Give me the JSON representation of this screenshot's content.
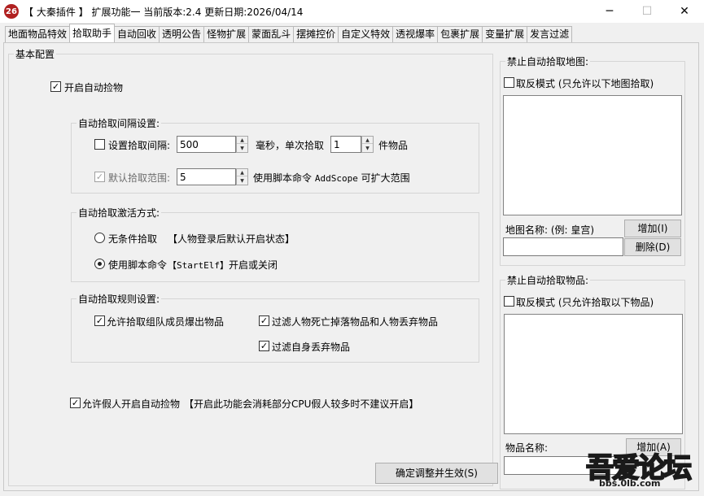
{
  "window": {
    "icon_text": "26",
    "title": "【 大秦插件 】 扩展功能一 当前版本:2.4 更新日期:2026/04/14",
    "minimize": "─",
    "maximize": "☐",
    "close": "✕"
  },
  "tabs": [
    "地面物品特效",
    "拾取助手",
    "自动回收",
    "透明公告",
    "怪物扩展",
    "蒙面乱斗",
    "摆摊控价",
    "自定义特效",
    "透视爆率",
    "包裹扩展",
    "变量扩展",
    "发言过滤"
  ],
  "active_tab": "拾取助手",
  "basic": {
    "legend": "基本配置",
    "auto_pickup": {
      "label": "开启自动捡物",
      "checked": true
    },
    "interval": {
      "legend": "自动拾取间隔设置:",
      "checkbox_label": "设置拾取间隔:",
      "checked": false,
      "interval_value": "500",
      "ms_label": "毫秒，单次拾取",
      "count_value": "1",
      "count_suffix": "件物品",
      "range_label": "默认拾取范围:",
      "range_checked": true,
      "range_value": "5",
      "range_hint_prefix": "使用脚本命令",
      "range_hint_cmd": "AddScope",
      "range_hint_suffix": "可扩大范围"
    },
    "activation": {
      "legend": "自动拾取激活方式:",
      "option1": "无条件拾取",
      "option1_hint": "【人物登录后默认开启状态】",
      "option2": "使用脚本命令",
      "option2_hint_cmd": "【StartElf】",
      "option2_hint_suffix": "开启或关闭",
      "selected": 2
    },
    "rules": {
      "legend": "自动拾取规则设置:",
      "rule1": "允许拾取组队成员爆出物品",
      "rule2": "过滤人物死亡掉落物品和人物丢弃物品",
      "rule3": "过滤自身丢弃物品"
    },
    "fake_player": {
      "label": "允许假人开启自动捡物",
      "hint": "【开启此功能会消耗部分CPU假人较多时不建议开启】",
      "checked": true
    },
    "apply_button": "确定调整并生效(S)"
  },
  "map_ban": {
    "legend": "禁止自动拾取地图:",
    "invert_label": "取反模式 (只允许以下地图拾取)",
    "name_label": "地图名称: (例: 皇宫)",
    "add_button": "增加(I)",
    "delete_button": "删除(D)"
  },
  "item_ban": {
    "legend": "禁止自动拾取物品:",
    "invert_label": "取反模式 (只允许拾取以下物品)",
    "name_label": "物品名称:",
    "add_button": "增加(A)"
  },
  "watermark": {
    "main": "吾爱论坛",
    "sub": "bbs.0lb.com"
  }
}
